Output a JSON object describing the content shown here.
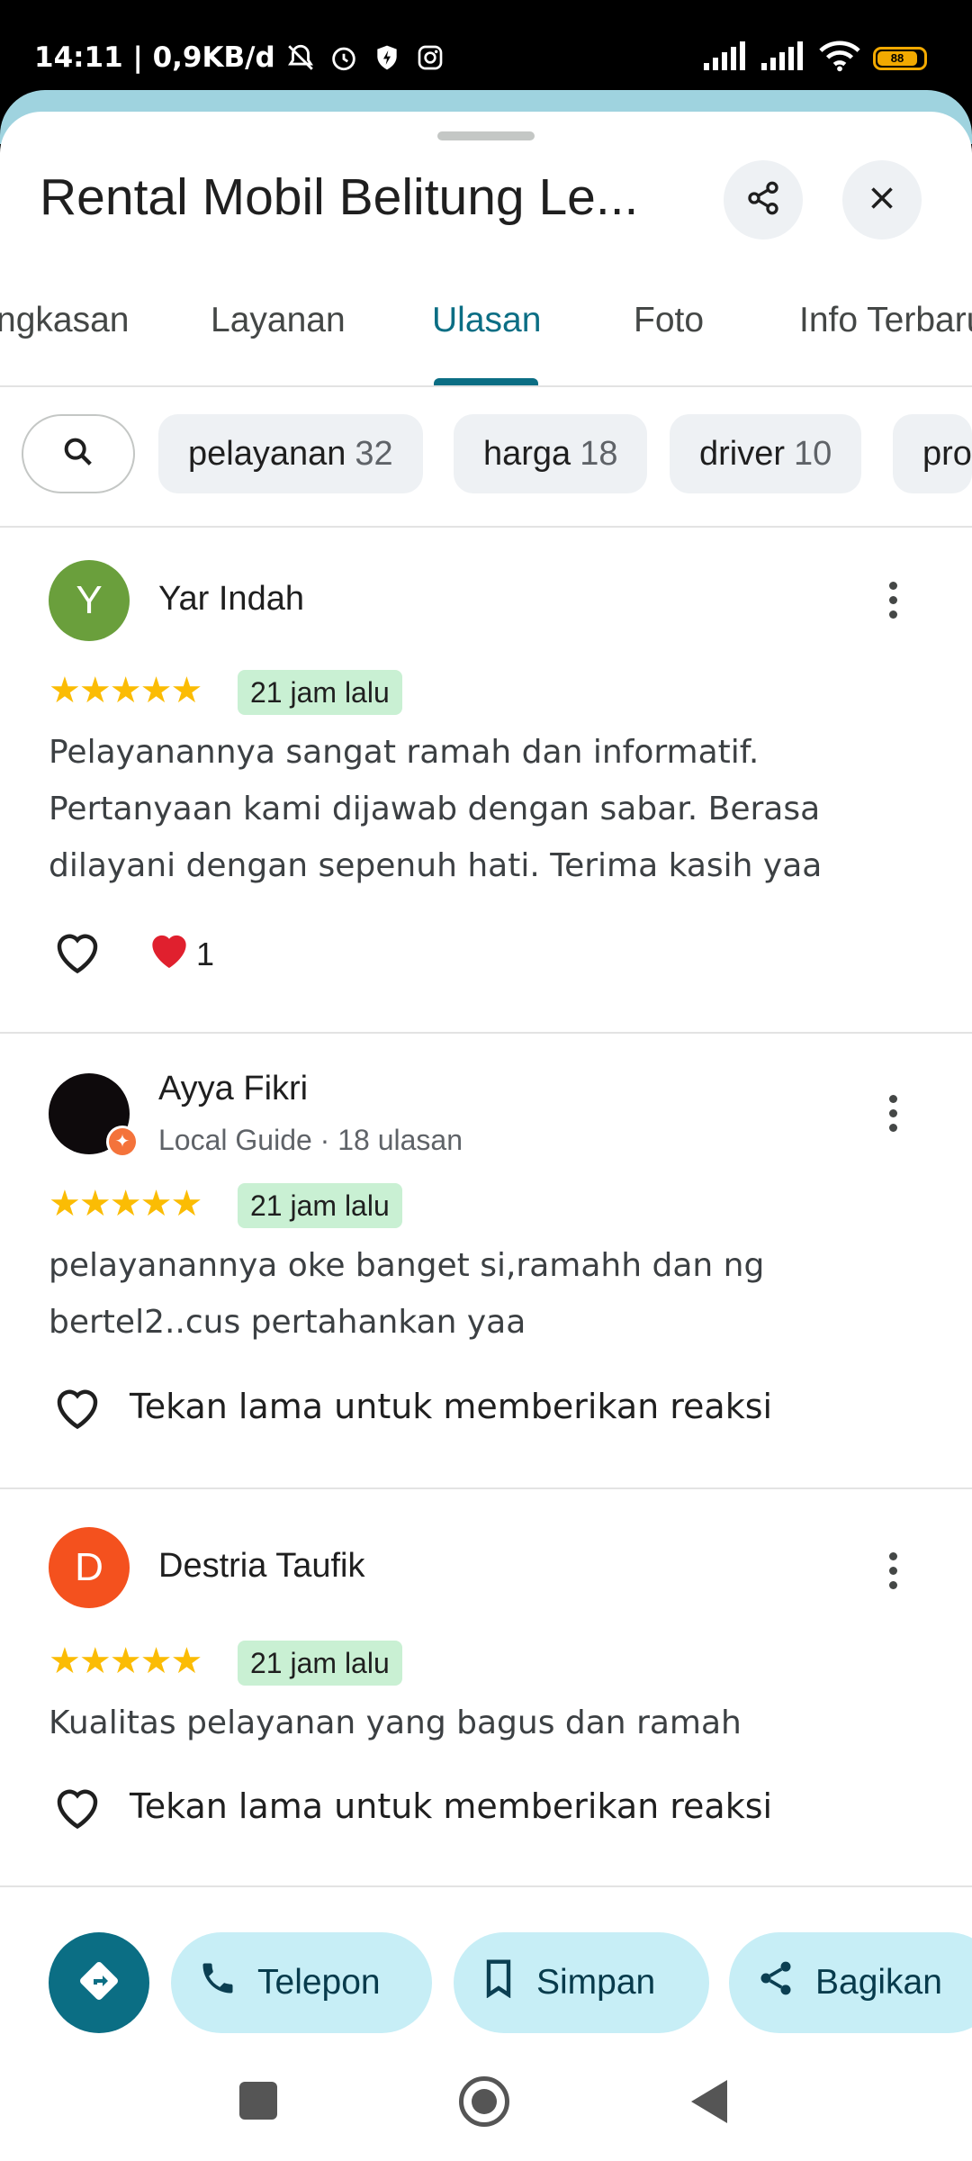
{
  "status_bar": {
    "time_and_speed": "14:11 | 0,9KB/d",
    "battery": "88",
    "icons": [
      "mute-bell-icon",
      "alarm-icon",
      "shield-bolt-icon",
      "instagram-icon",
      "signal-icon",
      "signal-icon",
      "wifi-icon",
      "battery-icon"
    ]
  },
  "header": {
    "title": "Rental Mobil Belitung Le...",
    "share_icon": "share-icon",
    "close_icon": "close-icon"
  },
  "tabs": [
    {
      "label": "ngkasan"
    },
    {
      "label": "Layanan"
    },
    {
      "label": "Ulasan",
      "active": true
    },
    {
      "label": "Foto"
    },
    {
      "label": "Info Terbaru"
    }
  ],
  "filters": {
    "search_icon": "search-icon",
    "chips": [
      {
        "label": "pelayanan",
        "count": "32"
      },
      {
        "label": "harga",
        "count": "18"
      },
      {
        "label": "driver",
        "count": "10"
      },
      {
        "label": "pro",
        "count": ""
      }
    ]
  },
  "reviews": [
    {
      "avatar_letter": "Y",
      "avatar_color": "#6a9f3c",
      "name": "Yar Indah",
      "subtitle": "",
      "rating": 5,
      "stars": "★★★★★",
      "time": "21 jam lalu",
      "text": "Pelayanannya sangat ramah dan informatif. Pertanyaan kami dijawab dengan sabar. Berasa dilayani dengan sepenuh hati. Terima kasih yaa",
      "reaction_emoji": "❤️",
      "reaction_count": "1"
    },
    {
      "avatar_letter": "",
      "avatar_color": "#0e0a0c",
      "name": "Ayya Fikri",
      "subtitle": "Local Guide · 18 ulasan",
      "rating": 5,
      "stars": "★★★★★",
      "time": "21 jam lalu",
      "text": "pelayanannya oke banget si,ramahh dan ng bertel2..cus pertahankan yaa",
      "reaction_prompt": "Tekan lama untuk memberikan reaksi"
    },
    {
      "avatar_letter": "D",
      "avatar_color": "#f4511e",
      "name": "Destria Taufik",
      "subtitle": "",
      "rating": 5,
      "stars": "★★★★★",
      "time": "21 jam lalu",
      "text": "Kualitas pelayanan yang bagus dan ramah",
      "reaction_prompt": "Tekan lama untuk memberikan reaksi"
    }
  ],
  "bottom_actions": {
    "route_icon": "directions-icon",
    "call_label": "Telepon",
    "save_label": "Simpan",
    "share_label": "Bagikan"
  },
  "colors": {
    "accent": "#0b6e84",
    "star": "#fbbc04",
    "badge_bg": "#c9f0d3",
    "pill_bg": "#c7eef6"
  }
}
